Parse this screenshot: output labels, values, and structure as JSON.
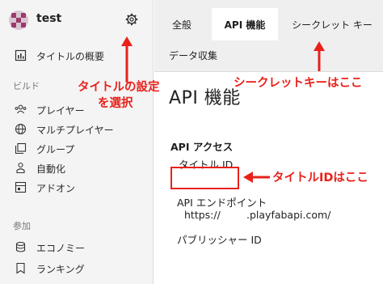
{
  "sidebar": {
    "title_name": "test",
    "overview_label": "タイトルの概要",
    "section_build": "ビルド",
    "build_items": [
      "プレイヤー",
      "マルチプレイヤー",
      "グループ",
      "自動化",
      "アドオン"
    ],
    "section_join": "参加",
    "join_items": [
      "エコノミー",
      "ランキング"
    ]
  },
  "tabs": {
    "general": "全般",
    "api": "API 機能",
    "secret": "シークレット キー",
    "data": "データ収集"
  },
  "main": {
    "page_title": "API 機能",
    "section_title": "API アクセス",
    "title_id_label": "タイトル ID",
    "endpoint_label": "API エンドポイント",
    "endpoint_prefix": "https://",
    "endpoint_suffix": ".playfabapi.com/",
    "publisher_label": "パブリッシャー ID"
  },
  "annotations": {
    "settings_line1": "タイトルの設定",
    "settings_line2": "を選択",
    "secret_key": "シークレットキーはここ",
    "title_id": "タイトルIDはここ"
  },
  "colors": {
    "annotation": "#e8211a",
    "sidebar_bg": "#f4f4f4",
    "tabs_bg": "#efefef"
  },
  "icons": [
    "gear-icon",
    "overview-icon",
    "players-icon",
    "globe-icon",
    "groups-icon",
    "automation-icon",
    "addons-icon",
    "economy-icon",
    "leaderboard-icon"
  ]
}
